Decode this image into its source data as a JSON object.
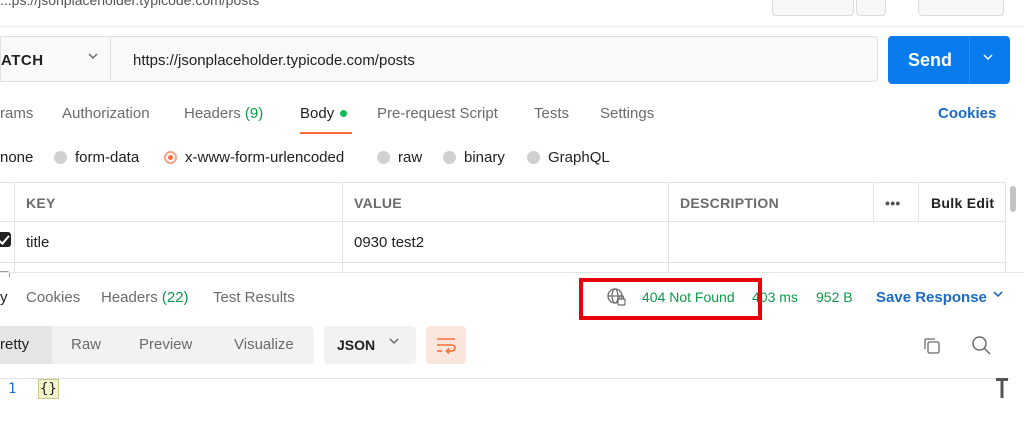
{
  "header": {
    "title_fragment": "...ps://jsonplaceholder.typicode.com/posts"
  },
  "request": {
    "method": "ATCH",
    "url": "https://jsonplaceholder.typicode.com/posts",
    "send_label": "Send"
  },
  "request_tabs": {
    "params": "rams",
    "authorization": "Authorization",
    "headers": "Headers",
    "headers_count": "(9)",
    "body": "Body",
    "prerequest": "Pre-request Script",
    "tests": "Tests",
    "settings": "Settings",
    "cookies": "Cookies"
  },
  "body_types": {
    "none": "none",
    "form_data": "form-data",
    "urlencoded": "x-www-form-urlencoded",
    "raw": "raw",
    "binary": "binary",
    "graphql": "GraphQL"
  },
  "table": {
    "headers": [
      "KEY",
      "VALUE",
      "DESCRIPTION"
    ],
    "more_label": "•••",
    "bulk_edit": "Bulk Edit",
    "rows": [
      {
        "key": "title",
        "value": "0930 test2",
        "description": ""
      }
    ]
  },
  "response": {
    "tabs": {
      "body": "y",
      "cookies": "Cookies",
      "headers": "Headers",
      "headers_count": "(22)",
      "test_results": "Test Results"
    },
    "status": "404 Not Found",
    "time": "403 ms",
    "size": "952 B",
    "save_response": "Save Response",
    "view_modes": [
      "retty",
      "Raw",
      "Preview",
      "Visualize"
    ],
    "format": "JSON",
    "line_number": "1",
    "content": "{}"
  },
  "colors": {
    "accent": "#ff6c37",
    "send": "#097bed",
    "success_text": "#0c9a49",
    "link": "#1c6ac2",
    "highlight_box": "#e8000b"
  }
}
